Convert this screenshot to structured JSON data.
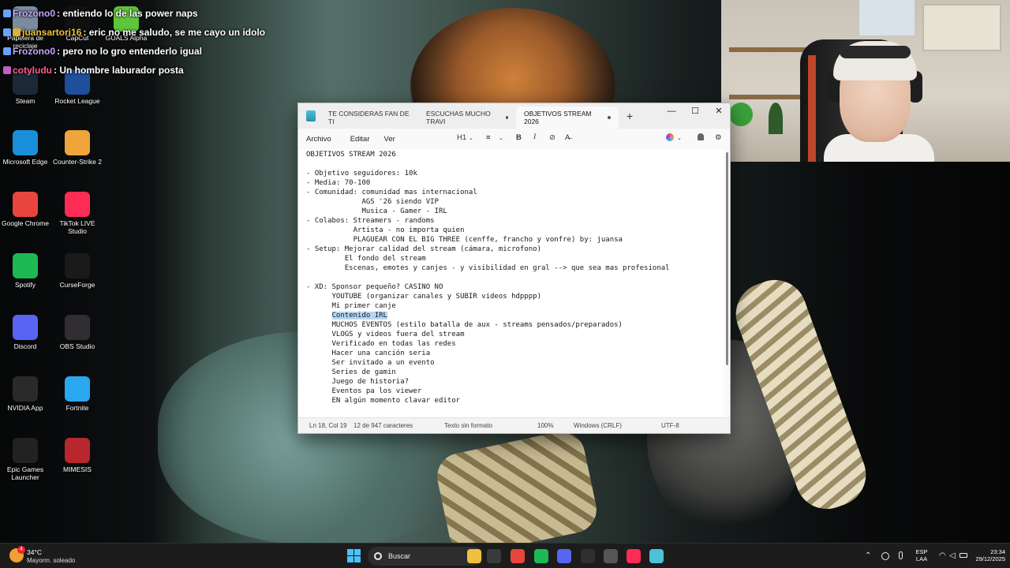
{
  "chat": [
    {
      "user": "Frozono0",
      "message": "entiendo lo de las power naps",
      "user_color": "#c8a6ff",
      "badge": "b1"
    },
    {
      "user": "juansartori16",
      "message": "eric no me saludo, se me cayo un idolo",
      "user_color": "#f0c23a",
      "badge": "b2"
    },
    {
      "user": "Frozono0",
      "message": "pero no lo gro entenderlo igual",
      "user_color": "#c8a6ff",
      "badge": "b1"
    },
    {
      "user": "cotyludu",
      "message": "Un hombre laburador posta",
      "user_color": "#ff5f8a",
      "badge": "b3"
    }
  ],
  "desktop_icons": [
    {
      "label": "Papelera de reciclaje",
      "icon": "recycle-bin-icon",
      "color": "#7a8da0"
    },
    {
      "label": "CapCut",
      "icon": "capcut-icon",
      "color": "#111111"
    },
    {
      "label": "GUALS Alpha",
      "icon": "guals-icon",
      "color": "#5ec63a"
    },
    {
      "label": "Steam",
      "icon": "steam-icon",
      "color": "#1b2838"
    },
    {
      "label": "Rocket League",
      "icon": "rocket-league-icon",
      "color": "#1d4f9a"
    },
    {
      "label": "Microsoft Edge",
      "icon": "edge-icon",
      "color": "#1a8fd9"
    },
    {
      "label": "Counter-Strike 2",
      "icon": "counter-strike-icon",
      "color": "#f0a53a"
    },
    {
      "label": "Google Chrome",
      "icon": "chrome-icon",
      "color": "#e8453c"
    },
    {
      "label": "TikTok LIVE Studio",
      "icon": "tiktok-icon",
      "color": "#fe2c55"
    },
    {
      "label": "Spotify",
      "icon": "spotify-icon",
      "color": "#1db954"
    },
    {
      "label": "CurseForge",
      "icon": "curseforge-icon",
      "color": "#1a1a1a"
    },
    {
      "label": "Discord",
      "icon": "discord-icon",
      "color": "#5865f2"
    },
    {
      "label": "OBS Studio",
      "icon": "obs-icon",
      "color": "#302e31"
    },
    {
      "label": "NVIDIA App",
      "icon": "nvidia-icon",
      "color": "#2a2a2a"
    },
    {
      "label": "Fortnite",
      "icon": "fortnite-icon",
      "color": "#2aa8f0"
    },
    {
      "label": "Epic Games Launcher",
      "icon": "epic-games-icon",
      "color": "#222222"
    },
    {
      "label": "MIMESIS",
      "icon": "mimesis-icon",
      "color": "#b8262e"
    }
  ],
  "notepad": {
    "tabs": [
      {
        "label": "TE CONSIDERAS FAN DE TI"
      },
      {
        "label": "ESCUCHAS MUCHO TRAVI"
      },
      {
        "label": "OBJETIVOS STREAM 2026"
      }
    ],
    "window_controls": {
      "minimize": "—",
      "maximize": "☐",
      "close": "✕"
    },
    "menu": {
      "file": "Archivo",
      "edit": "Editar",
      "view": "Ver"
    },
    "toolbar": {
      "heading": "H1",
      "list": "≡",
      "bold": "B",
      "italic": "I",
      "link": "⊘",
      "clear": "A̶"
    },
    "lines": [
      "OBJETIVOS STREAM 2026",
      "",
      "- Objetivo seguidores: 10k",
      "- Media: 70-100",
      "- Comunidad: comunidad mas internacional",
      "             AGS '26 siendo VIP",
      "             Musica - Gamer - IRL",
      "- Colabos: Streamers - randoms",
      "           Artista - no importa quien",
      "           PLAGUEAR CON EL BIG THREE (cenffe, francho y vonfre) by: juansa",
      "- Setup: Mejorar calidad del stream (cámara, microfono)",
      "         El fondo del stream",
      "         Escenas, emotes y canjes - y visibilidad en gral --> que sea mas profesional",
      "",
      "- XD: Sponsor pequeño? CASINO NO",
      "      YOUTUBE (organizar canales y SUBIR videos hdpppp)",
      "      Mi primer canje",
      "      Contenido IRL",
      "      MUCHOS EVENTOS (estilo batalla de aux - streams pensados/preparados)",
      "      VLOGS y videos fuera del stream",
      "      Verificado en todas las redes",
      "      Hacer una canción seria",
      "      Ser invitado a un evento",
      "      Series de gamin",
      "      Juego de historia?",
      "      Eventos pa los viewer",
      "      EN algún momento clavar editor"
    ],
    "selected_text": "Contenido IRL",
    "status": {
      "position": "Ln 18, Col 19",
      "chars": "12 de 947 caracteres",
      "format": "Texto sin formato",
      "zoom": "100%",
      "line_ending": "Windows (CRLF)",
      "encoding": "UTF-8"
    }
  },
  "taskbar": {
    "weather_temp": "34°C",
    "weather_desc": "Mayorm. soleado",
    "weather_badge": "4",
    "search_label": "Buscar",
    "lang_1": "ESP",
    "lang_2": "LAA",
    "time": "23:34",
    "date": "29/12/2025",
    "tray_chevron": "⌃",
    "pinned": [
      {
        "icon": "file-explorer-icon",
        "color": "#f0c040"
      },
      {
        "icon": "app-icon",
        "color": "#3a3a3a"
      },
      {
        "icon": "chrome-icon",
        "color": "#e8453c"
      },
      {
        "icon": "spotify-icon",
        "color": "#1db954"
      },
      {
        "icon": "discord-icon",
        "color": "#5865f2"
      },
      {
        "icon": "obs-icon",
        "color": "#302e31"
      },
      {
        "icon": "capture-icon",
        "color": "#555555"
      },
      {
        "icon": "tiktok-icon",
        "color": "#fe2c55"
      },
      {
        "icon": "notepad-icon",
        "color": "#4cc2d6"
      }
    ]
  }
}
